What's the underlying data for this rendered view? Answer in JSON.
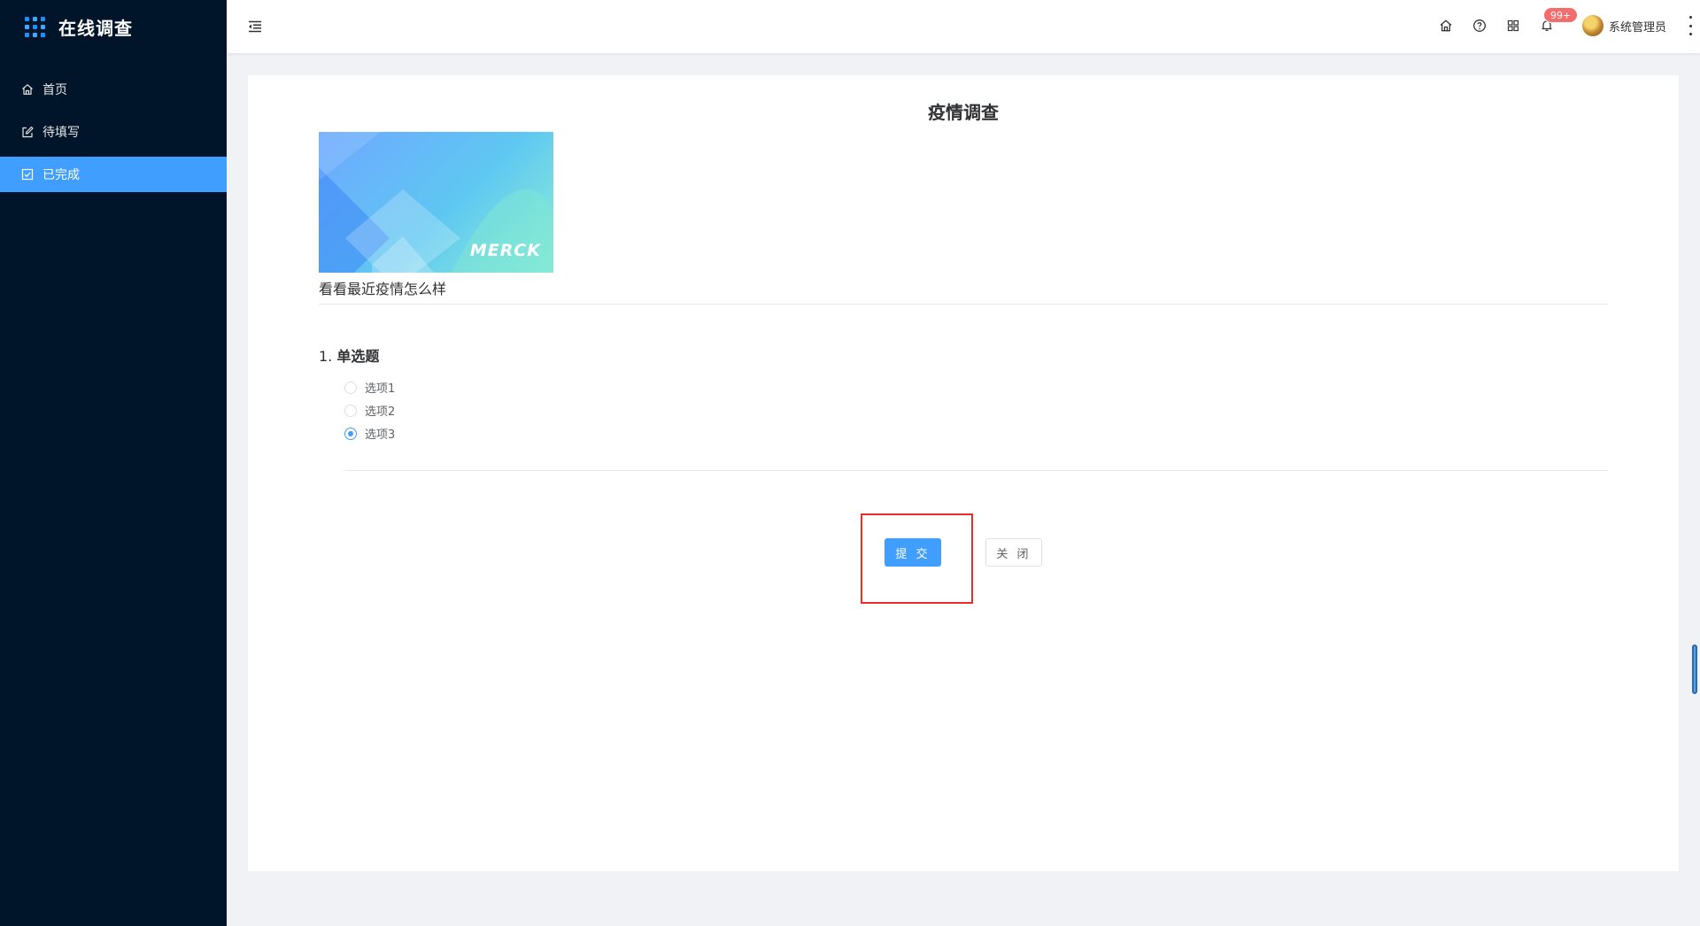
{
  "app": {
    "title": "在线调查",
    "brand_color": "#409eff",
    "sidebar_bg": "#001529"
  },
  "sidebar": {
    "items": [
      {
        "label": "首页",
        "icon": "home-icon",
        "active": false
      },
      {
        "label": "待填写",
        "icon": "edit-icon",
        "active": false
      },
      {
        "label": "已完成",
        "icon": "checkbox-icon",
        "active": true
      }
    ]
  },
  "header": {
    "notification_badge": "99+",
    "username": "系统管理员",
    "icons": [
      "menu-fold-icon",
      "home-icon",
      "help-icon",
      "apps-icon",
      "bell-icon",
      "more-icon"
    ]
  },
  "survey": {
    "title": "疫情调查",
    "banner_logo": "MERCK",
    "description": "看看最近疫情怎么样",
    "questions": [
      {
        "number": "1.",
        "type_label": "单选题",
        "options": [
          "选项1",
          "选项2",
          "选项3"
        ],
        "selected_index": 2
      }
    ]
  },
  "actions": {
    "submit_label": "提 交",
    "close_label": "关 闭"
  }
}
